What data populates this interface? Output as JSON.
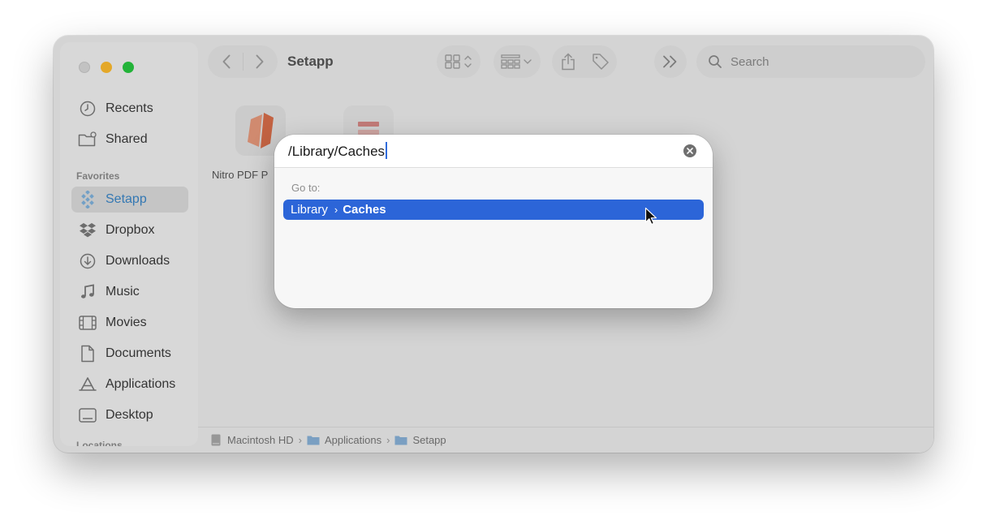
{
  "window": {
    "title": "Setapp",
    "search_placeholder": "Search"
  },
  "sidebar": {
    "items_top": [
      {
        "label": "Recents",
        "icon": "clock-icon"
      },
      {
        "label": "Shared",
        "icon": "shared-folder-icon"
      }
    ],
    "favorites_heading": "Favorites",
    "favorites": [
      {
        "label": "Setapp",
        "icon": "setapp-icon",
        "selected": true
      },
      {
        "label": "Dropbox",
        "icon": "dropbox-icon"
      },
      {
        "label": "Downloads",
        "icon": "download-icon"
      },
      {
        "label": "Music",
        "icon": "music-note-icon"
      },
      {
        "label": "Movies",
        "icon": "film-icon"
      },
      {
        "label": "Documents",
        "icon": "document-icon"
      },
      {
        "label": "Applications",
        "icon": "applications-icon"
      },
      {
        "label": "Desktop",
        "icon": "desktop-icon"
      }
    ],
    "locations_heading": "Locations"
  },
  "files": [
    {
      "label": "Nitro PDF P",
      "icon": "nitro-pdf-app-icon"
    },
    {
      "label": "",
      "icon": "app-icon"
    }
  ],
  "pathbar": [
    "Macintosh HD",
    "Applications",
    "Setapp"
  ],
  "go_to_dialog": {
    "input_value": "/Library/Caches",
    "section_label": "Go to:",
    "result": {
      "parent": "Library",
      "child": "Caches"
    }
  },
  "colors": {
    "accent": "#2c65d8",
    "sidebar_selected_text": "#3a86c8",
    "traffic_min": "#febc2e",
    "traffic_max": "#28c840"
  }
}
